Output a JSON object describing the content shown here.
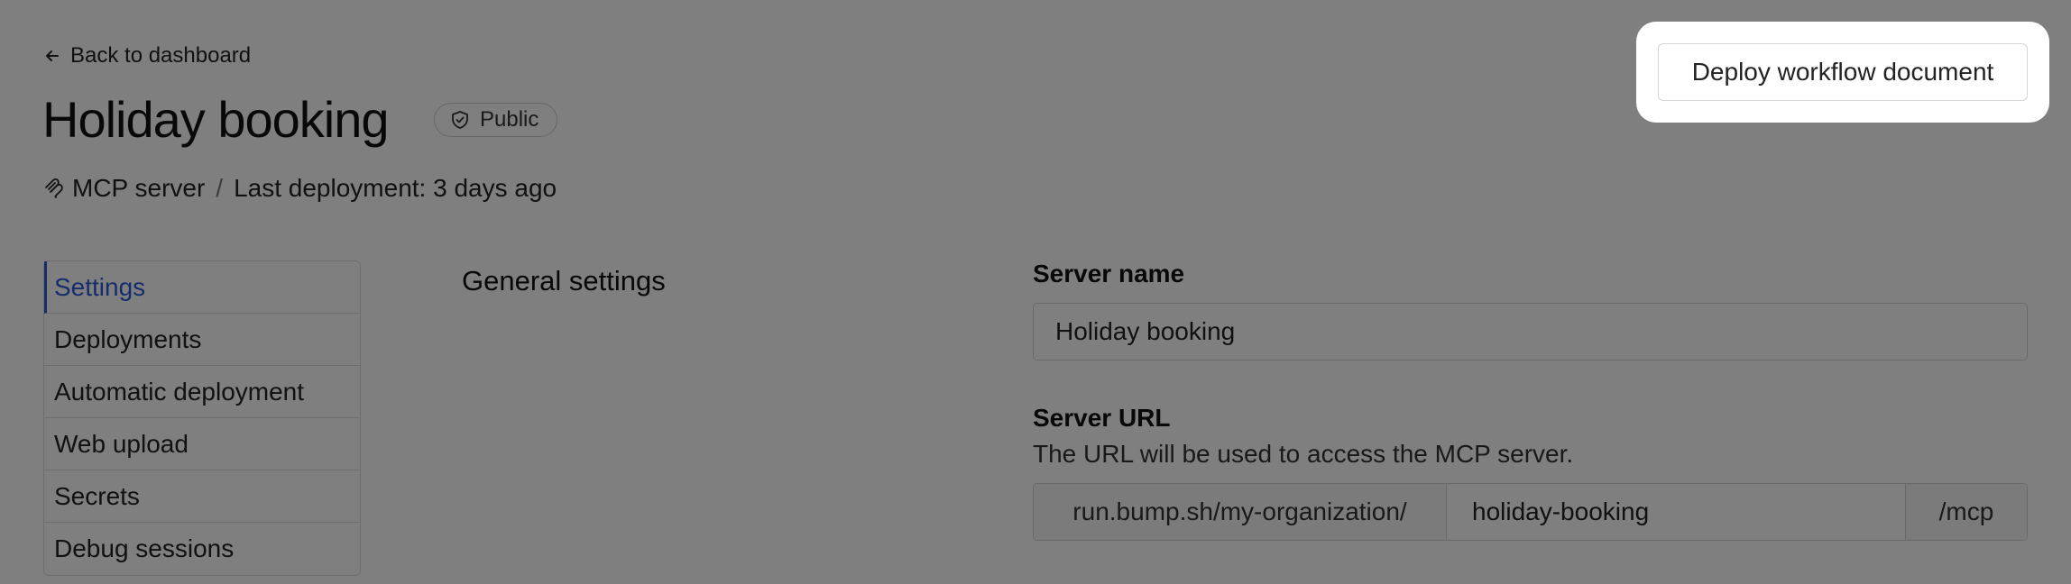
{
  "header": {
    "back_label": "Back to dashboard",
    "title": "Holiday booking",
    "visibility_badge": "Public",
    "server_type": "MCP server",
    "separator": "/",
    "last_deployment": "Last deployment: 3 days ago",
    "deploy_button_label": "Deploy workflow document"
  },
  "sidebar": {
    "items": [
      {
        "label": "Settings",
        "active": true
      },
      {
        "label": "Deployments"
      },
      {
        "label": "Automatic deployment"
      },
      {
        "label": "Web upload"
      },
      {
        "label": "Secrets"
      },
      {
        "label": "Debug sessions"
      }
    ]
  },
  "main": {
    "section_title": "General settings",
    "server_name": {
      "label": "Server name",
      "value": "Holiday booking"
    },
    "server_url": {
      "label": "Server URL",
      "help": "The URL will be used to access the MCP server.",
      "prefix": "run.bump.sh/my-organization/",
      "slug": "holiday-booking",
      "suffix": "/mcp"
    }
  },
  "icons": {
    "back": "arrow-left-icon",
    "badge": "shield-check-icon",
    "server_type": "mcp-logo-icon"
  },
  "colors": {
    "accent": "#2a5bd7",
    "overlay": "rgba(0,0,0,0.5)"
  }
}
